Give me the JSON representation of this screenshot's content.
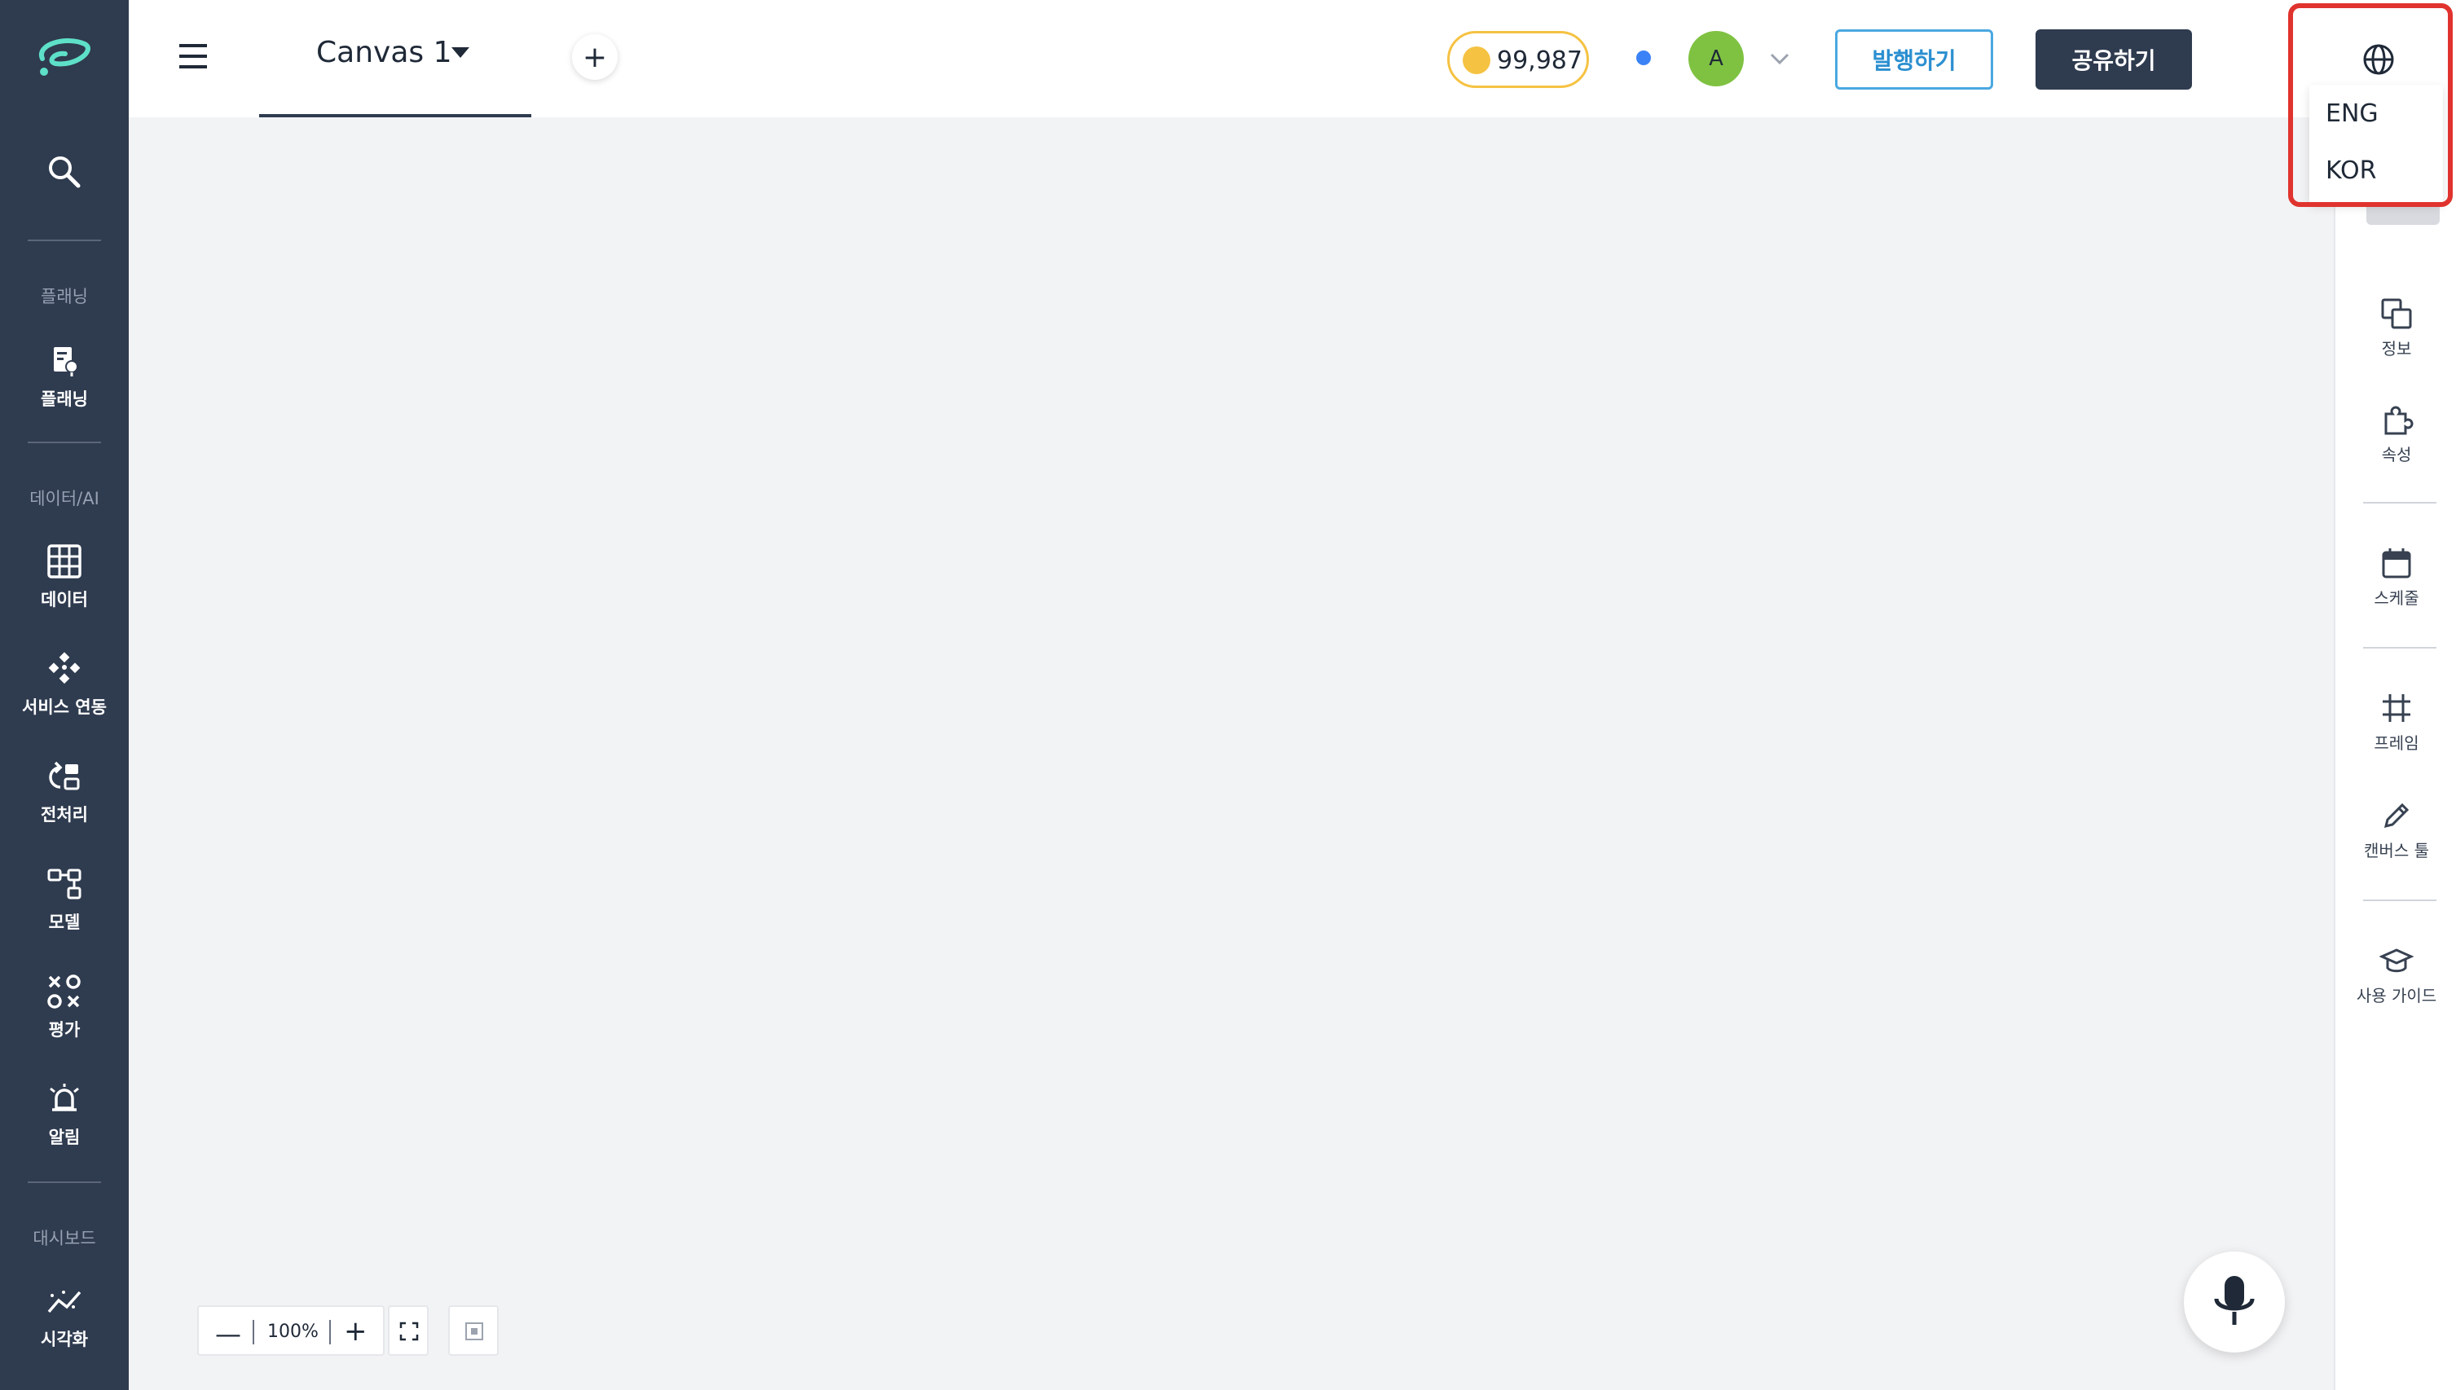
{
  "sidebar": {
    "sections": [
      {
        "label": "플래닝"
      },
      {
        "label": "데이터/AI"
      },
      {
        "label": "대시보드"
      }
    ],
    "items": [
      {
        "label": "플래닝",
        "icon": "planning-icon"
      },
      {
        "label": "데이터",
        "icon": "grid-icon"
      },
      {
        "label": "서비스 연동",
        "icon": "integration-icon"
      },
      {
        "label": "전처리",
        "icon": "preprocess-icon"
      },
      {
        "label": "모델",
        "icon": "model-icon"
      },
      {
        "label": "평가",
        "icon": "evaluate-icon"
      },
      {
        "label": "알림",
        "icon": "alarm-icon"
      },
      {
        "label": "시각화",
        "icon": "chart-icon"
      }
    ]
  },
  "topbar": {
    "tab_name": "Canvas 1",
    "coins": "99,987",
    "avatar_initial": "A",
    "publish_label": "발행하기",
    "share_label": "공유하기"
  },
  "language_menu": {
    "options": [
      "ENG",
      "KOR"
    ],
    "highlight_color": "#e0332e"
  },
  "rightbar": {
    "items": [
      {
        "label": "정보",
        "icon": "info-icon"
      },
      {
        "label": "속성",
        "icon": "puzzle-icon"
      },
      {
        "label": "스케줄",
        "icon": "calendar-icon"
      },
      {
        "label": "프레임",
        "icon": "frame-icon"
      },
      {
        "label": "캔버스 툴",
        "icon": "pencil-icon"
      },
      {
        "label": "사용 가이드",
        "icon": "graduation-cap-icon"
      }
    ]
  },
  "zoom": {
    "minus": "—",
    "level": "100%",
    "plus": "+"
  },
  "colors": {
    "sidebar": "#2f3b4f",
    "accent_blue": "#2b8fd0",
    "coin": "#f5c242",
    "avatar": "#7fc242"
  }
}
